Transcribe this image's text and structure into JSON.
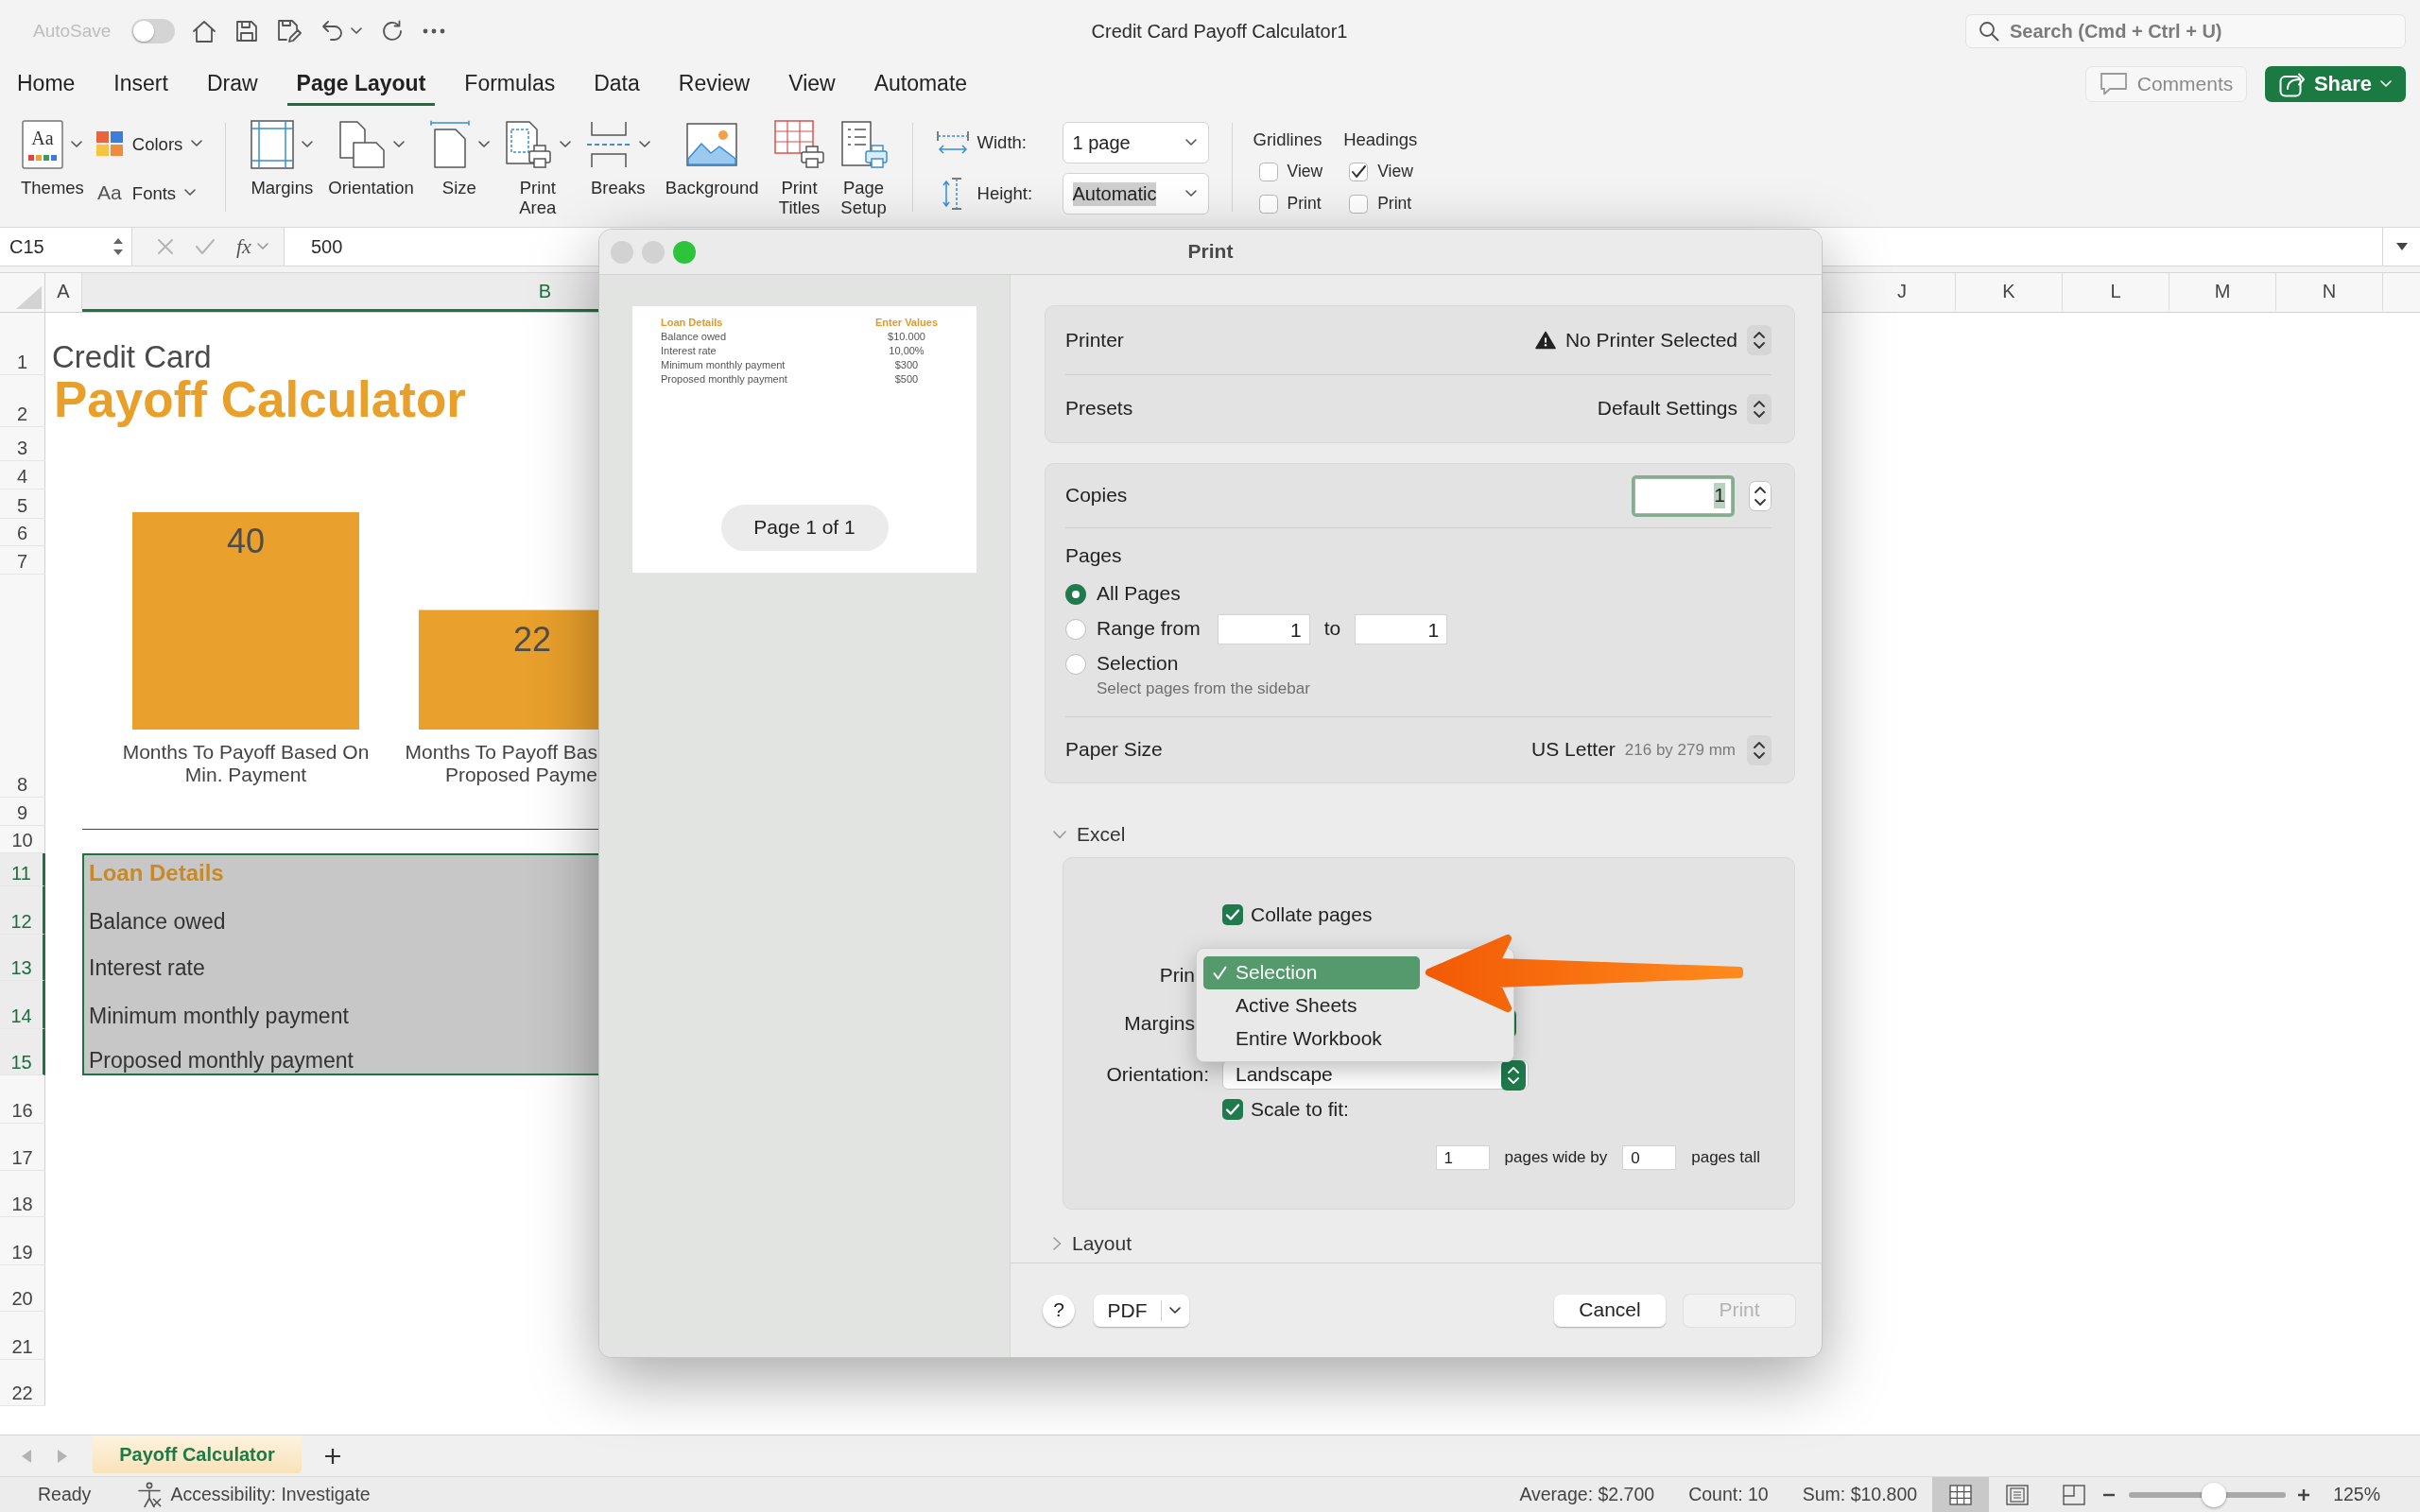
{
  "title_bar": {
    "autosave": {
      "label": "AutoSave",
      "on": false
    },
    "title": "Credit Card Payoff Calculator1",
    "search": {
      "placeholder": "Search (Cmd + Ctrl + U)"
    }
  },
  "tabs": [
    {
      "label": "Home",
      "selected": false
    },
    {
      "label": "Insert",
      "selected": false
    },
    {
      "label": "Draw",
      "selected": false
    },
    {
      "label": "Page Layout",
      "selected": true
    },
    {
      "label": "Formulas",
      "selected": false
    },
    {
      "label": "Data",
      "selected": false
    },
    {
      "label": "Review",
      "selected": false
    },
    {
      "label": "View",
      "selected": false
    },
    {
      "label": "Automate",
      "selected": false
    }
  ],
  "comments_button": {
    "label": "Comments"
  },
  "share_button": {
    "label": "Share"
  },
  "ribbon": {
    "themes": {
      "label": "Themes",
      "glyph": "Aa",
      "dropdown": true
    },
    "colors": {
      "label": "Colors",
      "dropdown": true
    },
    "fonts": {
      "label": "Fonts",
      "glyph": "Aa",
      "dropdown": true
    },
    "page_setup": [
      {
        "kind": "margins",
        "label": "Margins",
        "dropdown": true
      },
      {
        "kind": "orientation",
        "label": "Orientation",
        "dropdown": true
      },
      {
        "kind": "size",
        "label": "Size",
        "dropdown": true
      },
      {
        "kind": "print_area",
        "label": "Print\nArea",
        "dropdown": true
      },
      {
        "kind": "breaks",
        "label": "Breaks",
        "dropdown": true
      },
      {
        "kind": "background",
        "label": "Background",
        "dropdown": false
      },
      {
        "kind": "print_titles",
        "label": "Print\nTitles",
        "dropdown": false
      },
      {
        "kind": "page_setup",
        "label": "Page\nSetup",
        "dropdown": false
      }
    ],
    "scale": [
      {
        "kind": "width",
        "label": "Width:",
        "value": "1 page",
        "highlighted": false
      },
      {
        "kind": "height",
        "label": "Height:",
        "value": "Automatic",
        "highlighted": true
      }
    ],
    "sheet_options": [
      {
        "label": "Gridlines",
        "view": {
          "label": "View",
          "checked": false
        },
        "print": {
          "label": "Print",
          "checked": false
        }
      },
      {
        "label": "Headings",
        "view": {
          "label": "View",
          "checked": true
        },
        "print": {
          "label": "Print",
          "checked": false
        }
      }
    ]
  },
  "formula_bar": {
    "cell": "C15",
    "function_label": "fx",
    "value": "500"
  },
  "sheet": {
    "columns": [
      {
        "label": "A",
        "selected": false
      },
      {
        "label": "B",
        "selected": true
      },
      {
        "label": "J",
        "selected": false
      },
      {
        "label": "K",
        "selected": false
      },
      {
        "label": "L",
        "selected": false
      },
      {
        "label": "M",
        "selected": false
      },
      {
        "label": "N",
        "selected": false
      }
    ],
    "rows": [
      {
        "label": "1",
        "selected": false
      },
      {
        "label": "2",
        "selected": false
      },
      {
        "label": "3",
        "selected": false
      },
      {
        "label": "4",
        "selected": false
      },
      {
        "label": "5",
        "selected": false
      },
      {
        "label": "6",
        "selected": false
      },
      {
        "label": "7",
        "selected": false
      },
      {
        "label": "8",
        "selected": false
      },
      {
        "label": "9",
        "selected": false
      },
      {
        "label": "10",
        "selected": false
      },
      {
        "label": "11",
        "selected": true
      },
      {
        "label": "12",
        "selected": true
      },
      {
        "label": "13",
        "selected": true
      },
      {
        "label": "14",
        "selected": true
      },
      {
        "label": "15",
        "selected": true
      },
      {
        "label": "16",
        "selected": false
      },
      {
        "label": "17",
        "selected": false
      },
      {
        "label": "18",
        "selected": false
      },
      {
        "label": "19",
        "selected": false
      },
      {
        "label": "20",
        "selected": false
      },
      {
        "label": "21",
        "selected": false
      },
      {
        "label": "22",
        "selected": false
      }
    ],
    "subtitle": "Credit Card",
    "title": "Payoff Calculator",
    "chart_data": {
      "type": "bar",
      "categories": [
        "Months To Payoff Based On\nMin. Payment",
        "Months To Payoff Bas\nProposed Payme"
      ],
      "values": [
        40,
        22
      ],
      "data_labels": true
    },
    "loan_details": {
      "heading": "Loan Details",
      "items": [
        "Balance owed",
        "Interest rate",
        "Minimum monthly payment",
        "Proposed monthly payment"
      ]
    }
  },
  "sheet_tabs": [
    {
      "label": "Payoff Calculator",
      "selected": true
    }
  ],
  "status_bar": {
    "status": "Ready",
    "accessibility": "Accessibility: Investigate",
    "stats": [
      "Average: $2.700",
      "Count: 10",
      "Sum: $10.800"
    ],
    "views": [
      {
        "kind": "normal",
        "selected": true
      },
      {
        "kind": "page_layout",
        "selected": false
      },
      {
        "kind": "page_break",
        "selected": false
      }
    ],
    "zoom": {
      "level": 0.54,
      "reading": "125%"
    }
  },
  "print_dialog": {
    "title": "Print",
    "window_buttons": [
      {
        "color": "#d2d2d2"
      },
      {
        "color": "#d2d2d2"
      },
      {
        "color": "#2dc43c"
      }
    ],
    "preview": {
      "rows": [
        {
          "kind": "header",
          "label": "Loan Details",
          "value": "Enter Values"
        },
        {
          "kind": "item",
          "label": "Balance owed",
          "value": "$10.000"
        },
        {
          "kind": "item",
          "label": "Interest rate",
          "value": "10,00%"
        },
        {
          "kind": "item",
          "label": "Minimum monthly payment",
          "value": "$300"
        },
        {
          "kind": "item",
          "label": "Proposed monthly payment",
          "value": "$500"
        }
      ],
      "page_label": "Page 1 of 1"
    },
    "printer": {
      "label": "Printer",
      "value": "No Printer Selected",
      "warning": true
    },
    "presets": {
      "label": "Presets",
      "value": "Default Settings"
    },
    "copies": {
      "label": "Copies",
      "value": "1",
      "highlighted": true
    },
    "pages": {
      "label": "Pages",
      "options": [
        {
          "kind": "all",
          "label": "All Pages",
          "selected": true
        },
        {
          "kind": "range",
          "label": "Range from",
          "selected": false,
          "from": "1",
          "to_label": "to",
          "to": "1"
        },
        {
          "kind": "selection",
          "label": "Selection",
          "selected": false,
          "hint": "Select pages from the sidebar"
        }
      ]
    },
    "paper_size": {
      "label": "Paper Size",
      "value": "US Letter",
      "detail": "216 by 279 mm"
    },
    "excel": {
      "label": "Excel",
      "expanded": true,
      "collate": {
        "label": "Collate pages",
        "checked": true
      },
      "print": {
        "label": "Prin",
        "menu": [
          {
            "label": "Selection",
            "selected": true
          },
          {
            "label": "Active Sheets",
            "selected": false
          },
          {
            "label": "Entire Workbook",
            "selected": false
          }
        ]
      },
      "margins": {
        "label": "Margins"
      },
      "orientation": {
        "label": "Orientation:",
        "value": "Landscape"
      },
      "scale": {
        "label": "Scale to fit:",
        "checked": true,
        "wide": "1",
        "wide_label": "pages wide by",
        "tall": "0",
        "tall_label": "pages tall"
      }
    },
    "layout": {
      "label": "Layout",
      "expanded": false
    },
    "footer": {
      "help": "?",
      "pdf": "PDF",
      "cancel": "Cancel",
      "print": {
        "label": "Print",
        "disabled": true
      }
    }
  }
}
